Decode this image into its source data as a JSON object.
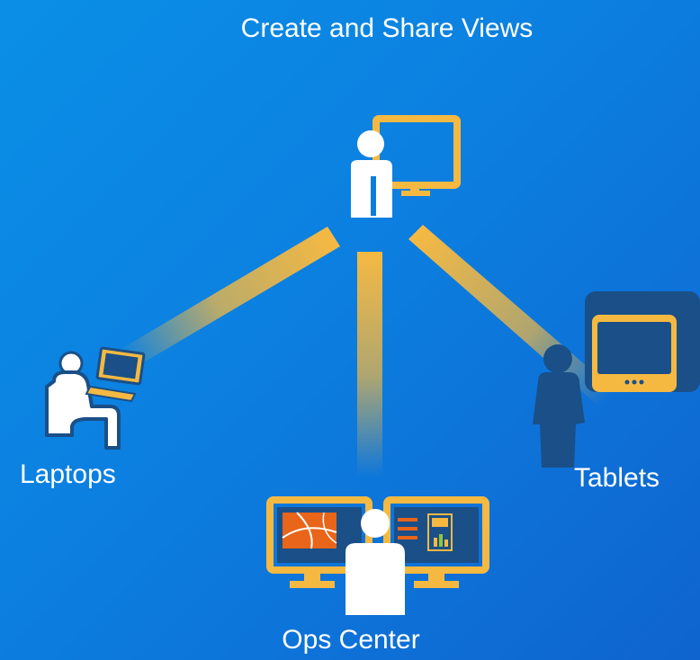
{
  "hub": {
    "title": "Create and Share Views",
    "icon": "presenter-monitor-icon"
  },
  "nodes": {
    "laptops": {
      "label": "Laptops",
      "icon": "person-laptop-icon"
    },
    "tablets": {
      "label": "Tablets",
      "icon": "person-tablet-icon"
    },
    "ops_center": {
      "label": "Ops Center",
      "icon": "ops-center-monitors-icon"
    }
  },
  "colors": {
    "background_start": "#0a8fe6",
    "background_end": "#0f64cf",
    "connector": "#f5b942",
    "accent_orange": "#e8651a",
    "white": "#ffffff",
    "navy": "#1a4f87"
  }
}
